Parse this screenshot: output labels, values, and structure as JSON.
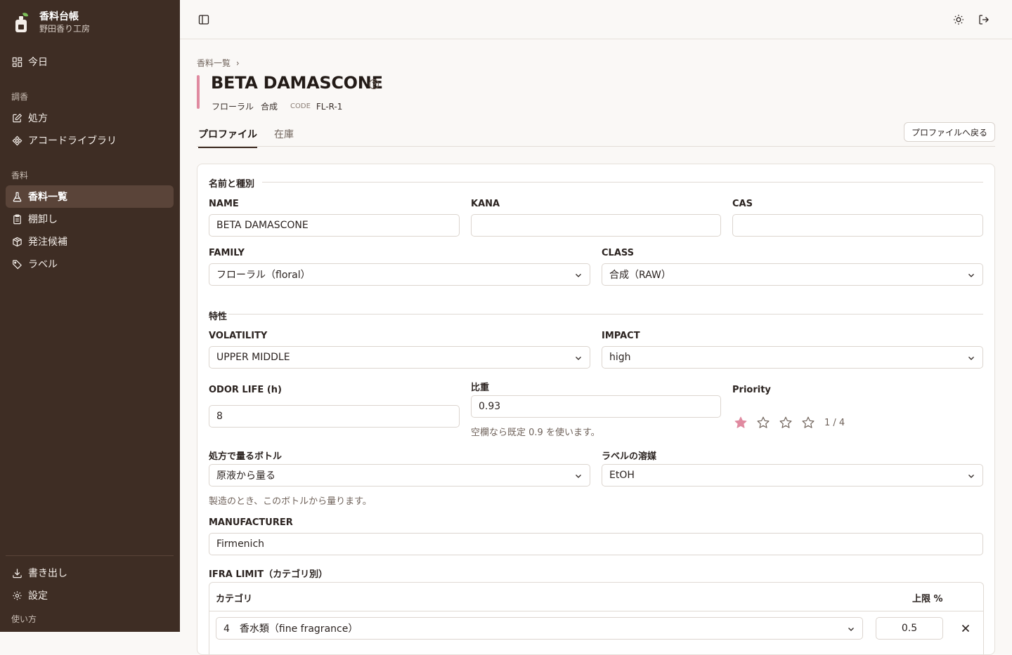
{
  "brand": {
    "name": "香料台帳",
    "workshop": "野田香り工房"
  },
  "nav": {
    "today": "今日",
    "section_blend": "調香",
    "formula": "処方",
    "accord_library": "アコードライブラリ",
    "section_material": "香料",
    "material_list": "香料一覧",
    "stocktake": "棚卸し",
    "order_candidates": "発注候補",
    "labels": "ラベル",
    "export": "書き出し",
    "settings": "設定",
    "usage": "使い方"
  },
  "breadcrumb": {
    "parent": "香料一覧",
    "sep": "›"
  },
  "material": {
    "title": "BETA DAMASCONE",
    "family_tag": "フローラル",
    "class_tag": "合成",
    "code_label": "CODE",
    "code": "FL-R-1",
    "accent_color": "#e08aa0"
  },
  "tabs": {
    "profile": "プロファイル",
    "stock": "在庫"
  },
  "back_button": "プロファイルへ戻る",
  "form": {
    "section_name": "名前と種別",
    "name_label": "NAME",
    "name_value": "BETA DAMASCONE",
    "kana_label": "KANA",
    "kana_value": "",
    "cas_label": "CAS",
    "cas_value": "",
    "family_label": "FAMILY",
    "family_value": "フローラル（floral）",
    "class_label": "CLASS",
    "class_value": "合成（RAW）",
    "section_traits": "特性",
    "volatility_label": "VOLATILITY",
    "volatility_value": "UPPER MIDDLE",
    "impact_label": "IMPACT",
    "impact_value": "high",
    "odor_life_label": "ODOR LIFE (h)",
    "odor_life_value": "8",
    "gravity_label": "比重",
    "gravity_value": "0.93",
    "gravity_hint": "空欄なら既定 0.9 を使います。",
    "priority_label": "Priority",
    "priority_value": 1,
    "priority_max": 4,
    "priority_text": "1 / 4",
    "bottle_label": "処方で量るボトル",
    "bottle_value": "原液から量る",
    "bottle_hint": "製造のとき、このボトルから量ります。",
    "solvent_label": "ラベルの溶媒",
    "solvent_value": "EtOH",
    "manufacturer_label": "MANUFACTURER",
    "manufacturer_value": "Firmenich",
    "ifra_label": "IFRA LIMIT（カテゴリ別）",
    "ifra_col_category": "カテゴリ",
    "ifra_col_limit": "上限 %",
    "ifra_rows": [
      {
        "category": "4　香水類（fine fragrance）",
        "limit": "0.5"
      }
    ]
  }
}
